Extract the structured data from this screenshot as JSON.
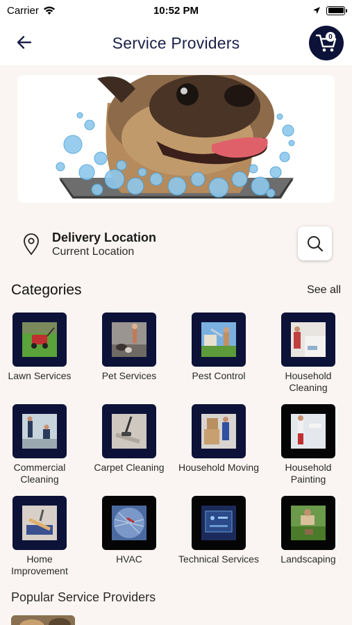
{
  "status_bar": {
    "carrier": "Carrier",
    "time": "10:52 PM"
  },
  "header": {
    "title": "Service Providers",
    "cart_count": "0"
  },
  "location": {
    "title": "Delivery Location",
    "subtitle": "Current Location"
  },
  "categories": {
    "title": "Categories",
    "see_all": "See all",
    "items": [
      {
        "label": "Lawn Services",
        "icon": "lawn-mower"
      },
      {
        "label": "Pet Services",
        "icon": "pet-walking"
      },
      {
        "label": "Pest Control",
        "icon": "pest-spray"
      },
      {
        "label": "Household Cleaning",
        "icon": "cleaning"
      },
      {
        "label": "Commercial Cleaning",
        "icon": "commercial-cleaning"
      },
      {
        "label": "Carpet Cleaning",
        "icon": "carpet-vacuum"
      },
      {
        "label": "Household Moving",
        "icon": "moving-boxes"
      },
      {
        "label": "Household Painting",
        "icon": "painting"
      },
      {
        "label": "Home Improvement",
        "icon": "tools"
      },
      {
        "label": "HVAC",
        "icon": "hvac-fan"
      },
      {
        "label": "Technical Services",
        "icon": "tech-screen"
      },
      {
        "label": "Landscaping",
        "icon": "landscaping"
      }
    ]
  },
  "popular": {
    "title": "Popular Service Providers"
  },
  "colors": {
    "navy": "#0c1238",
    "background": "#faf5f2"
  }
}
